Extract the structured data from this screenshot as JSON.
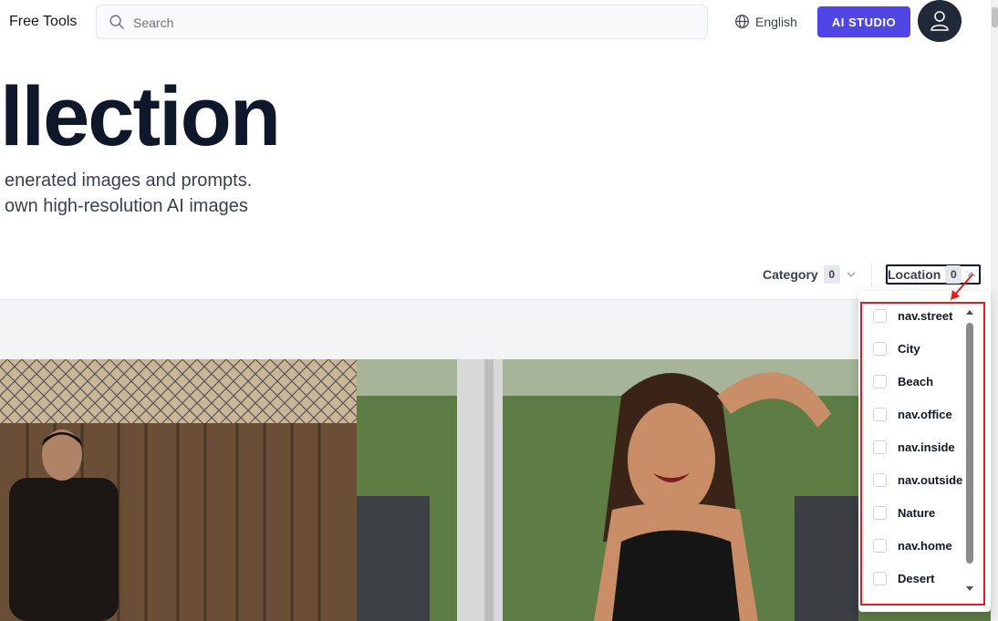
{
  "header": {
    "free_tools": "Free Tools",
    "search_placeholder": "Search",
    "language": "English",
    "studio_button": "AI STUDIO"
  },
  "hero": {
    "title": "llection",
    "subtitle_line1": "enerated images and prompts.",
    "subtitle_line2": "own high-resolution AI images"
  },
  "filters": {
    "category": {
      "label": "Category",
      "count": "0"
    },
    "location": {
      "label": "Location",
      "count": "0"
    }
  },
  "location_options": [
    "nav.street",
    "City",
    "Beach",
    "nav.office",
    "nav.inside",
    "nav.outside",
    "Nature",
    "nav.home",
    "Desert"
  ],
  "colors": {
    "accent": "#4f46e5",
    "highlight": "#e11d1d",
    "avatar_bg": "#1f2937"
  },
  "images": [
    {
      "icon": "photo-man-by-fence"
    },
    {
      "icon": "photo-woman-smiling"
    }
  ]
}
